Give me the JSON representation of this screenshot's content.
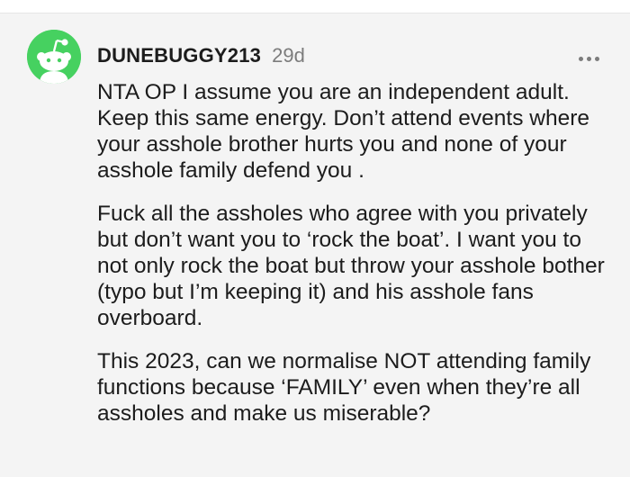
{
  "comment": {
    "author": "DUNEBUGGY213",
    "age": "29d",
    "more_icon": "ellipsis-horizontal-icon",
    "avatar_icon": "snoo-avatar-icon",
    "avatar_color": "#46d160",
    "paragraphs": [
      "NTA OP I assume you are an independent adult. Keep this same energy. Don’t attend events where your asshole brother hurts you and none of your asshole family defend you .",
      "Fuck all the assholes who agree with you privately but don’t want you to ‘rock the boat’. I want you to not only rock the boat but throw your asshole bother (typo but I’m keeping it) and his asshole fans overboard.",
      "This 2023, can we normalise NOT attending family functions because ‘FAMILY’ even when they’re all assholes and make us miserable?"
    ]
  }
}
